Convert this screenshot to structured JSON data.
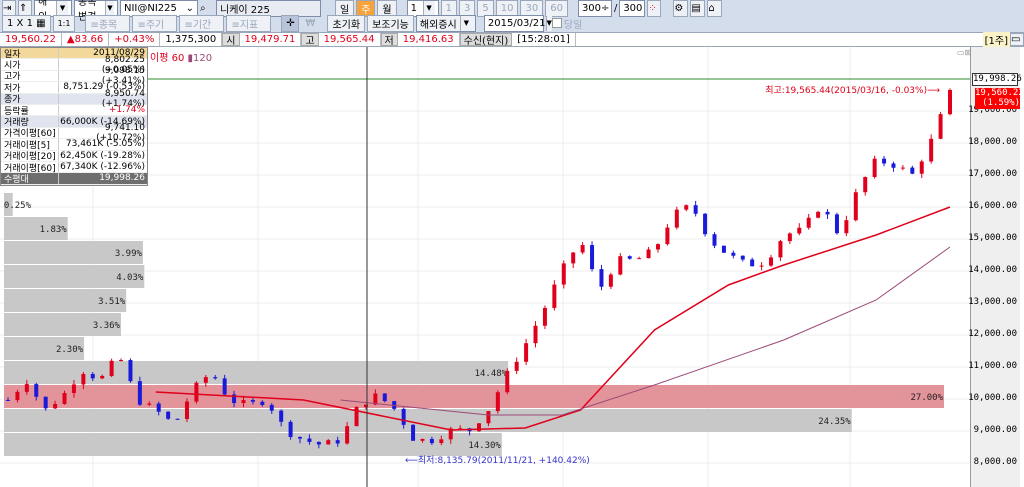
{
  "toolbar1": {
    "market": "해외",
    "change_item": "종목변경",
    "code": "NII@NI225",
    "name": "니케이 225",
    "periods": [
      "일",
      "주",
      "월"
    ],
    "active_period": "주",
    "count": "1",
    "num_buttons": [
      "1",
      "3",
      "5",
      "10",
      "30",
      "60"
    ],
    "display_count": "300",
    "total_count": "300"
  },
  "toolbar2": {
    "layout": "1 X 1",
    "one_one": "1:1",
    "tabs": [
      "≡종목",
      "≡주기",
      "≡기간",
      "≡지표"
    ],
    "reset": "초기화",
    "aux": "보조기능",
    "overseas": "해외증시",
    "date": "2015/03/21",
    "pin_label": "당일"
  },
  "quote": {
    "price": "19,560.22",
    "change": "▲83.66",
    "pct": "+0.43%",
    "volume": "1,375,300",
    "open_label": "시",
    "open": "19,479.71",
    "high_label": "고",
    "high": "19,565.44",
    "low_label": "저",
    "low": "19,416.63",
    "feed": "수신(현지)",
    "time": "[15:28:01]",
    "period_tag": "[1주]"
  },
  "info_panel": {
    "header": [
      "일자",
      "2011/08/29"
    ],
    "rows": [
      [
        "시가",
        "8,802.25 (+0.05%)"
      ],
      [
        "고가",
        "9,098.15 (+3.41%)"
      ],
      [
        "저가",
        "8,751.29 (-0.53%)"
      ],
      [
        "종가",
        "8,950.74 (+1.74%)"
      ],
      [
        "등락률",
        "+1.74%"
      ],
      [
        "거래량",
        "66,000K (-14.69%)"
      ],
      [
        "가격이평[60]",
        "9,741.10 (+10.72%)"
      ],
      [
        "거래이평[5]",
        "73,461K (-5.05%)"
      ],
      [
        "거래이평[20]",
        "62,450K (-19.28%)"
      ],
      [
        "거래이평[60]",
        "67,340K (-12.96%)"
      ]
    ],
    "footer": [
      "수평대",
      "19,998.26"
    ]
  },
  "legend": {
    "label": "이평",
    "ma1": "60",
    "ma2": "120",
    "ma1_color": "#e0001b",
    "ma2_color": "#9b4a78"
  },
  "chart_data": {
    "type": "candlestick",
    "ylim": [
      7700,
      20500
    ],
    "y_ticks": [
      "19,000.00",
      "18,000.00",
      "17,000.00",
      "16,000.00",
      "15,000.00",
      "14,000.00",
      "13,000.00",
      "12,000.00",
      "11,000.00",
      "10,000.00",
      "9,000.00",
      "8,000.00"
    ],
    "y_tick_values": [
      19000,
      18000,
      17000,
      16000,
      15000,
      14000,
      13000,
      12000,
      11000,
      10000,
      9000,
      8000
    ],
    "close_knots": [
      9970,
      10590,
      9650,
      10125,
      10900,
      10600,
      11375,
      9970,
      9650,
      9190,
      10280,
      10850,
      9970,
      9810,
      9970,
      9030,
      8720,
      8560,
      8720,
      9810,
      10125,
      9650,
      8720,
      8720,
      9030,
      9030,
      9660,
      10750,
      11690,
      12780,
      14030,
      14970,
      13400,
      14340,
      14340,
      14660,
      15750,
      16060,
      14970,
      14500,
      14190,
      14280,
      15125,
      15280,
      16060,
      15125,
      16530,
      17470,
      17310,
      17000,
      18090,
      19560
    ],
    "ma60_knots": [
      [
        8,
        10219
      ],
      [
        16,
        9969
      ],
      [
        24,
        9031
      ],
      [
        28,
        9094
      ],
      [
        31,
        9656
      ],
      [
        35,
        12156
      ],
      [
        39,
        13563
      ],
      [
        42,
        14188
      ],
      [
        47,
        15125
      ],
      [
        51,
        16000
      ]
    ],
    "ma120_knots": [
      [
        18,
        9969
      ],
      [
        26,
        9500
      ],
      [
        30,
        9500
      ],
      [
        35,
        10438
      ],
      [
        42,
        11844
      ],
      [
        47,
        13094
      ],
      [
        51,
        14750
      ]
    ],
    "horizontal_line": {
      "value": 19998.26,
      "label": "19,998.26",
      "color": "#2e8b2e"
    },
    "last_label": {
      "price": "19,560.22",
      "pct": "(1.59%)"
    },
    "high_annotation": "최고:19,565.44(2015/03/16, -0.03%)⟶",
    "low_annotation": "⟵최저:8,135.79(2011/11/21, +140.42%)",
    "volume_profile": [
      {
        "pct": "0.25%",
        "value": 0.25
      },
      {
        "pct": "1.83%",
        "value": 1.83
      },
      {
        "pct": "3.99%",
        "value": 3.99
      },
      {
        "pct": "4.03%",
        "value": 4.03
      },
      {
        "pct": "3.51%",
        "value": 3.51
      },
      {
        "pct": "3.36%",
        "value": 3.36
      },
      {
        "pct": "2.30%",
        "value": 2.3
      },
      {
        "pct": "14.48%",
        "value": 14.48
      },
      {
        "pct": "27.00%",
        "value": 27.0,
        "highlight": true
      },
      {
        "pct": "24.35%",
        "value": 24.35
      },
      {
        "pct": "14.30%",
        "value": 14.3
      }
    ],
    "up_color": "#e0001b",
    "down_color": "#1a1adb"
  }
}
